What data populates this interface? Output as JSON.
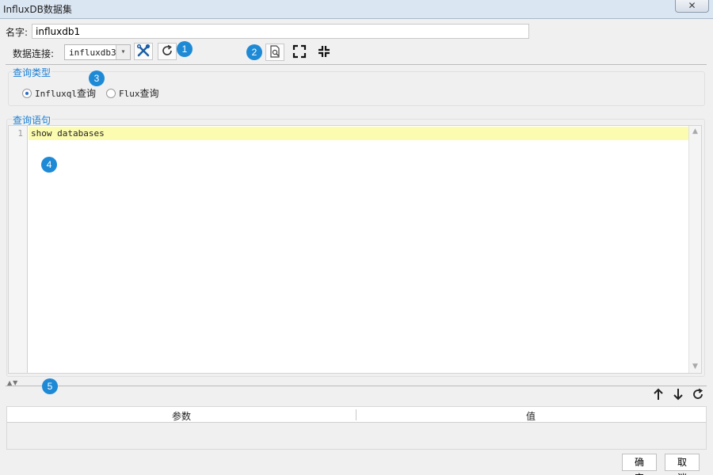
{
  "window": {
    "title": "InfluxDB数据集",
    "close_glyph": "✕"
  },
  "name": {
    "label": "名字:",
    "value": "influxdb1"
  },
  "connection": {
    "label": "数据连接:",
    "selected": "influxdb3",
    "dropdown_glyph": "▾"
  },
  "badges": [
    "1",
    "2",
    "3",
    "4",
    "5"
  ],
  "icons": {
    "settings": "wrench-screwdriver-icon",
    "refresh": "refresh-icon",
    "preview": "preview-document-icon",
    "expand": "expand-icon",
    "collapse": "collapse-icon",
    "move_up": "arrow-up-icon",
    "move_down": "arrow-down-icon",
    "refresh_params": "refresh-icon"
  },
  "query_type": {
    "title": "查询类型",
    "options": [
      {
        "prefix": "Influxql",
        "suffix": "查询",
        "checked": true
      },
      {
        "prefix": "Flux",
        "suffix": "查询",
        "checked": false
      }
    ]
  },
  "query": {
    "title": "查询语句",
    "line_numbers": [
      "1"
    ],
    "lines": [
      "show databases"
    ],
    "scroll_up_glyph": "▲",
    "scroll_down_glyph": "▼"
  },
  "splitter": {
    "glyph": "▲▼"
  },
  "params_table": {
    "columns": [
      "参数",
      "值"
    ]
  },
  "footer": {
    "ok": "确定",
    "cancel": "取消"
  },
  "colors": {
    "accent": "#1e8ad6",
    "section_title": "#1a7fd4",
    "current_line": "#fcfcb0"
  }
}
